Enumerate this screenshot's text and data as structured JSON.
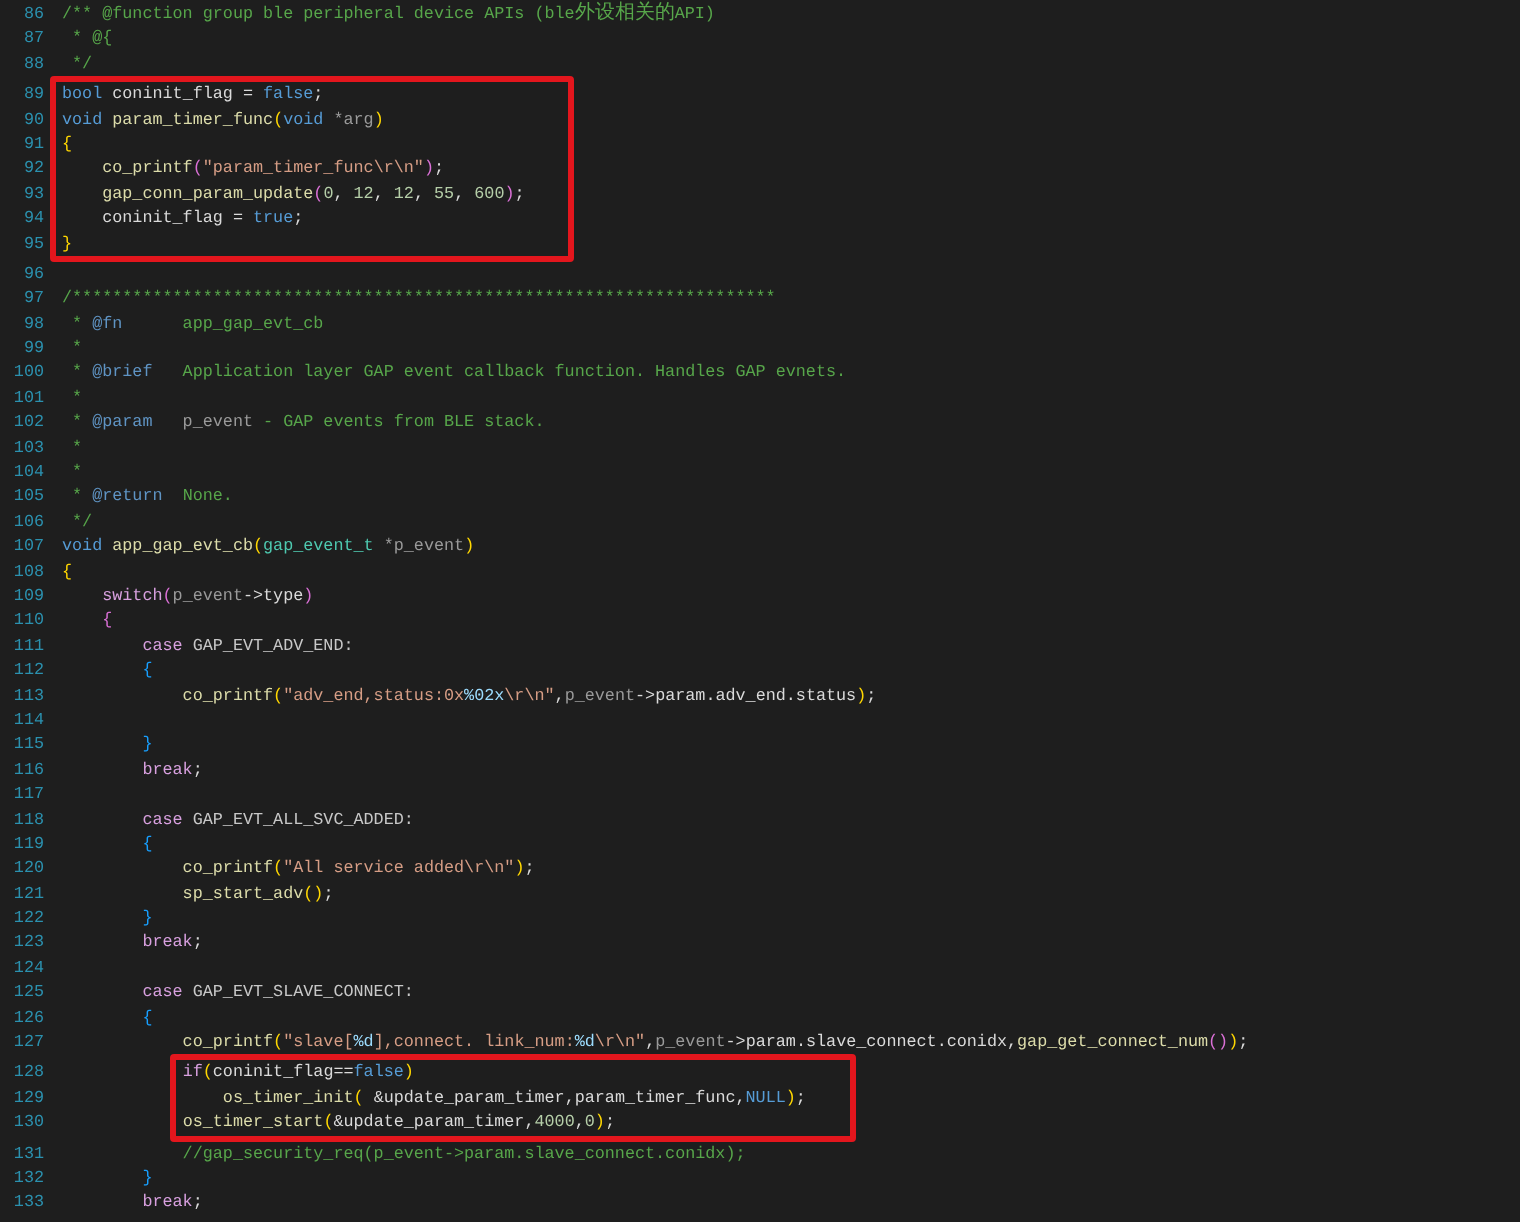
{
  "blocks": [
    {
      "kind": "plain",
      "lines": [
        {
          "n": "86",
          "tokens": [
            {
              "text": "/** @function group ble peripheral device APIs (ble外设相关的API)",
              "kind": "comment"
            }
          ]
        },
        {
          "n": "87",
          "tokens": [
            {
              "text": " * @{",
              "kind": "comment"
            }
          ]
        },
        {
          "n": "88",
          "tokens": [
            {
              "text": " */",
              "kind": "comment"
            }
          ]
        }
      ]
    },
    {
      "kind": "boxed",
      "lines": [
        {
          "n": "89",
          "tokens": [
            {
              "text": "bool",
              "kind": "keyword"
            },
            {
              "text": " coninit_flag = ",
              "kind": "plain"
            },
            {
              "text": "false",
              "kind": "keyword"
            },
            {
              "text": ";",
              "kind": "plain"
            }
          ]
        },
        {
          "n": "90",
          "tokens": [
            {
              "text": "void",
              "kind": "keyword"
            },
            {
              "text": " param_timer_func",
              "kind": "function"
            },
            {
              "text": "(",
              "kind": "bracket_gold"
            },
            {
              "text": "void",
              "kind": "keyword"
            },
            {
              "text": " *arg",
              "kind": "param"
            },
            {
              "text": ")",
              "kind": "bracket_gold"
            }
          ]
        },
        {
          "n": "91",
          "tokens": [
            {
              "text": "{",
              "kind": "bracket_gold"
            }
          ]
        },
        {
          "n": "92",
          "tokens": [
            {
              "text": "    co_printf",
              "kind": "function"
            },
            {
              "text": "(",
              "kind": "bracket_purple"
            },
            {
              "text": "\"param_timer_func\\r\\n\"",
              "kind": "string"
            },
            {
              "text": ")",
              "kind": "bracket_purple"
            },
            {
              "text": ";",
              "kind": "plain"
            }
          ]
        },
        {
          "n": "93",
          "tokens": [
            {
              "text": "    gap_conn_param_update",
              "kind": "function"
            },
            {
              "text": "(",
              "kind": "bracket_purple"
            },
            {
              "text": "0",
              "kind": "number"
            },
            {
              "text": ", ",
              "kind": "plain"
            },
            {
              "text": "12",
              "kind": "number"
            },
            {
              "text": ", ",
              "kind": "plain"
            },
            {
              "text": "12",
              "kind": "number"
            },
            {
              "text": ", ",
              "kind": "plain"
            },
            {
              "text": "55",
              "kind": "number"
            },
            {
              "text": ", ",
              "kind": "plain"
            },
            {
              "text": "600",
              "kind": "number"
            },
            {
              "text": ")",
              "kind": "bracket_purple"
            },
            {
              "text": ";",
              "kind": "plain"
            }
          ]
        },
        {
          "n": "94",
          "tokens": [
            {
              "text": "    coninit_flag = ",
              "kind": "plain"
            },
            {
              "text": "true",
              "kind": "keyword"
            },
            {
              "text": ";",
              "kind": "plain"
            }
          ]
        },
        {
          "n": "95",
          "tokens": [
            {
              "text": "}",
              "kind": "bracket_gold"
            }
          ]
        }
      ]
    },
    {
      "kind": "plain",
      "lines": [
        {
          "n": "96"
        },
        {
          "n": "97",
          "tokens": [
            {
              "text": "/**********************************************************************",
              "kind": "comment"
            }
          ]
        },
        {
          "n": "98",
          "tokens": [
            {
              "text": " * ",
              "kind": "comment"
            },
            {
              "text": "@fn",
              "kind": "doc_tag"
            },
            {
              "text": "      app_gap_evt_cb",
              "kind": "comment"
            }
          ]
        },
        {
          "n": "99",
          "tokens": [
            {
              "text": " *",
              "kind": "comment"
            }
          ]
        },
        {
          "n": "100",
          "tokens": [
            {
              "text": " * ",
              "kind": "comment"
            },
            {
              "text": "@brief",
              "kind": "doc_tag"
            },
            {
              "text": "   Application layer GAP event callback function. Handles GAP evnets.",
              "kind": "comment"
            }
          ]
        },
        {
          "n": "101",
          "tokens": [
            {
              "text": " *",
              "kind": "comment"
            }
          ]
        },
        {
          "n": "102",
          "tokens": [
            {
              "text": " * ",
              "kind": "comment"
            },
            {
              "text": "@param",
              "kind": "doc_tag"
            },
            {
              "text": "   p_event",
              "kind": "param"
            },
            {
              "text": " - GAP events from BLE stack.",
              "kind": "comment"
            }
          ]
        },
        {
          "n": "103",
          "tokens": [
            {
              "text": " *",
              "kind": "comment"
            }
          ]
        },
        {
          "n": "104",
          "tokens": [
            {
              "text": " *",
              "kind": "comment"
            }
          ]
        },
        {
          "n": "105",
          "tokens": [
            {
              "text": " * ",
              "kind": "comment"
            },
            {
              "text": "@return",
              "kind": "doc_tag"
            },
            {
              "text": "  None.",
              "kind": "comment"
            }
          ]
        },
        {
          "n": "106",
          "tokens": [
            {
              "text": " */",
              "kind": "comment"
            }
          ]
        },
        {
          "n": "107",
          "tokens": [
            {
              "text": "void",
              "kind": "keyword"
            },
            {
              "text": " app_gap_evt_cb",
              "kind": "function"
            },
            {
              "text": "(",
              "kind": "bracket_gold"
            },
            {
              "text": "gap_event_t",
              "kind": "type"
            },
            {
              "text": " *p_event",
              "kind": "param"
            },
            {
              "text": ")",
              "kind": "bracket_gold"
            }
          ]
        },
        {
          "n": "108",
          "tokens": [
            {
              "text": "{",
              "kind": "bracket_gold"
            }
          ]
        },
        {
          "n": "109",
          "tokens": [
            {
              "text": "    switch",
              "kind": "control"
            },
            {
              "text": "(",
              "kind": "bracket_purple"
            },
            {
              "text": "p_event",
              "kind": "param"
            },
            {
              "text": "->type",
              "kind": "plain"
            },
            {
              "text": ")",
              "kind": "bracket_purple"
            }
          ]
        },
        {
          "n": "110",
          "tokens": [
            {
              "text": "    {",
              "kind": "bracket_purple"
            }
          ]
        },
        {
          "n": "111",
          "tokens": [
            {
              "text": "        case",
              "kind": "control"
            },
            {
              "text": " GAP_EVT_ADV_END:",
              "kind": "macro"
            }
          ]
        },
        {
          "n": "112",
          "tokens": [
            {
              "text": "        {",
              "kind": "bracket_blue"
            }
          ]
        },
        {
          "n": "113",
          "tokens": [
            {
              "text": "            co_printf",
              "kind": "function"
            },
            {
              "text": "(",
              "kind": "bracket_gold"
            },
            {
              "text": "\"adv_end,status:0x",
              "kind": "string"
            },
            {
              "text": "%02x",
              "kind": "escape"
            },
            {
              "text": "\\r\\n\"",
              "kind": "string"
            },
            {
              "text": ",",
              "kind": "plain"
            },
            {
              "text": "p_event",
              "kind": "param"
            },
            {
              "text": "->param.adv_end.status",
              "kind": "plain"
            },
            {
              "text": ")",
              "kind": "bracket_gold"
            },
            {
              "text": ";",
              "kind": "plain"
            }
          ]
        },
        {
          "n": "114"
        },
        {
          "n": "115",
          "tokens": [
            {
              "text": "        }",
              "kind": "bracket_blue"
            }
          ]
        },
        {
          "n": "116",
          "tokens": [
            {
              "text": "        break",
              "kind": "control"
            },
            {
              "text": ";",
              "kind": "plain"
            }
          ]
        },
        {
          "n": "117"
        },
        {
          "n": "118",
          "tokens": [
            {
              "text": "        case",
              "kind": "control"
            },
            {
              "text": " GAP_EVT_ALL_SVC_ADDED:",
              "kind": "macro"
            }
          ]
        },
        {
          "n": "119",
          "tokens": [
            {
              "text": "        {",
              "kind": "bracket_blue"
            }
          ]
        },
        {
          "n": "120",
          "tokens": [
            {
              "text": "            co_printf",
              "kind": "function"
            },
            {
              "text": "(",
              "kind": "bracket_gold"
            },
            {
              "text": "\"All service added\\r\\n\"",
              "kind": "string"
            },
            {
              "text": ")",
              "kind": "bracket_gold"
            },
            {
              "text": ";",
              "kind": "plain"
            }
          ]
        },
        {
          "n": "121",
          "tokens": [
            {
              "text": "            sp_start_adv",
              "kind": "function"
            },
            {
              "text": "()",
              "kind": "bracket_gold"
            },
            {
              "text": ";",
              "kind": "plain"
            }
          ]
        },
        {
          "n": "122",
          "tokens": [
            {
              "text": "        }",
              "kind": "bracket_blue"
            }
          ]
        },
        {
          "n": "123",
          "tokens": [
            {
              "text": "        break",
              "kind": "control"
            },
            {
              "text": ";",
              "kind": "plain"
            }
          ]
        },
        {
          "n": "124"
        },
        {
          "n": "125",
          "tokens": [
            {
              "text": "        case",
              "kind": "control"
            },
            {
              "text": " GAP_EVT_SLAVE_CONNECT:",
              "kind": "macro"
            }
          ]
        },
        {
          "n": "126",
          "tokens": [
            {
              "text": "        {",
              "kind": "bracket_blue"
            }
          ]
        },
        {
          "n": "127",
          "tokens": [
            {
              "text": "            co_printf",
              "kind": "function"
            },
            {
              "text": "(",
              "kind": "bracket_gold"
            },
            {
              "text": "\"slave[",
              "kind": "string"
            },
            {
              "text": "%d",
              "kind": "escape"
            },
            {
              "text": "],connect. link_num:",
              "kind": "string"
            },
            {
              "text": "%d",
              "kind": "escape"
            },
            {
              "text": "\\r\\n\"",
              "kind": "string"
            },
            {
              "text": ",",
              "kind": "plain"
            },
            {
              "text": "p_event",
              "kind": "param"
            },
            {
              "text": "->param.slave_connect.conidx,",
              "kind": "plain"
            },
            {
              "text": "gap_get_connect_num",
              "kind": "function"
            },
            {
              "text": "()",
              "kind": "bracket_purple"
            },
            {
              "text": ")",
              "kind": "bracket_gold"
            },
            {
              "text": ";",
              "kind": "plain"
            }
          ]
        }
      ]
    },
    {
      "kind": "boxed",
      "lines": [
        {
          "n": "128",
          "tokens": [
            {
              "text": "            if",
              "kind": "control"
            },
            {
              "text": "(",
              "kind": "bracket_gold"
            },
            {
              "text": "coninit_flag==",
              "kind": "plain"
            },
            {
              "text": "false",
              "kind": "keyword"
            },
            {
              "text": ")",
              "kind": "bracket_gold"
            }
          ]
        },
        {
          "n": "129",
          "tokens": [
            {
              "text": "                os_timer_init",
              "kind": "function"
            },
            {
              "text": "(",
              "kind": "bracket_gold"
            },
            {
              "text": " &update_param_timer,param_timer_func,",
              "kind": "plain"
            },
            {
              "text": "NULL",
              "kind": "keyword"
            },
            {
              "text": ")",
              "kind": "bracket_gold"
            },
            {
              "text": ";",
              "kind": "plain"
            }
          ]
        },
        {
          "n": "130",
          "tokens": [
            {
              "text": "            os_timer_start",
              "kind": "function"
            },
            {
              "text": "(",
              "kind": "bracket_gold"
            },
            {
              "text": "&update_param_timer,",
              "kind": "plain"
            },
            {
              "text": "4000",
              "kind": "number"
            },
            {
              "text": ",",
              "kind": "plain"
            },
            {
              "text": "0",
              "kind": "number"
            },
            {
              "text": ")",
              "kind": "bracket_gold"
            },
            {
              "text": ";",
              "kind": "plain"
            }
          ]
        }
      ]
    },
    {
      "kind": "plain",
      "lines": [
        {
          "n": "131",
          "tokens": [
            {
              "text": "            //gap_security_req(p_event->param.slave_connect.conidx);",
              "kind": "comment"
            }
          ]
        },
        {
          "n": "132",
          "tokens": [
            {
              "text": "        }",
              "kind": "bracket_blue"
            }
          ]
        },
        {
          "n": "133",
          "tokens": [
            {
              "text": "        break",
              "kind": "control"
            },
            {
              "text": ";",
              "kind": "plain"
            }
          ]
        }
      ]
    }
  ]
}
